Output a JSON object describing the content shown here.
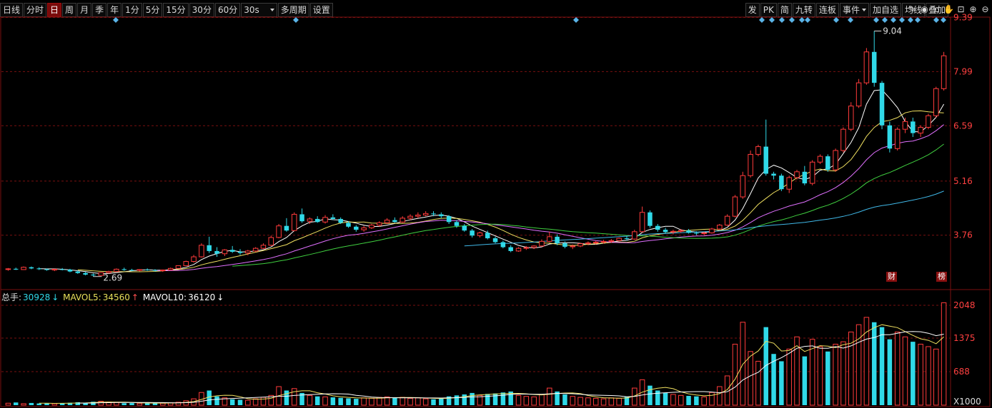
{
  "toolbar": {
    "left_items": [
      {
        "label": "日线",
        "active": false
      },
      {
        "label": "分时",
        "active": false
      },
      {
        "label": "日",
        "active": true
      },
      {
        "label": "周",
        "active": false
      },
      {
        "label": "月",
        "active": false
      },
      {
        "label": "季",
        "active": false
      },
      {
        "label": "年",
        "active": false
      },
      {
        "label": "1分",
        "active": false
      },
      {
        "label": "5分",
        "active": false
      },
      {
        "label": "15分",
        "active": false
      },
      {
        "label": "30分",
        "active": false
      },
      {
        "label": "60分",
        "active": false
      }
    ],
    "period_select": "30s",
    "multi_period": "多周期",
    "settings": "设置",
    "right_items": [
      "发",
      "PK",
      "简",
      "九转",
      "连板",
      "事件",
      "加自选",
      "均线",
      "叠加"
    ],
    "tool_icons": [
      "pen-icon",
      "eye-icon",
      "camera-icon",
      "hand-icon",
      "lock-icon",
      "zoom-in-icon",
      "zoom-out-icon"
    ]
  },
  "price_axis": {
    "labels": [
      "9.39",
      "7.99",
      "6.59",
      "5.16",
      "3.76"
    ]
  },
  "volume_axis": {
    "labels": [
      "2048",
      "1375",
      "688",
      "X1000"
    ]
  },
  "volume_info": {
    "total_label": "总手:",
    "total_value": "30928",
    "mavol5_label": "MAVOL5:",
    "mavol5_value": "34560",
    "mavol10_label": "MAVOL10:",
    "mavol10_value": "36120"
  },
  "markers": {
    "cai": "财",
    "bang": "榜"
  },
  "colors": {
    "up": "#ff3b3b",
    "down": "#30d9e8",
    "ma5": "#ffffff",
    "ma10": "#f0e060",
    "ma20": "#e070ff",
    "ma30": "#40d040",
    "ma60": "#40b8e8",
    "grid": "#7a1010"
  },
  "chart_data": {
    "type": "candlestick",
    "ylim_price": [
      2.5,
      9.4
    ],
    "ylim_volume": [
      0,
      2150
    ],
    "annotations": [
      {
        "text": "9.04",
        "kind": "high"
      },
      {
        "text": "2.69",
        "kind": "low"
      }
    ],
    "candles": [
      [
        2.88,
        2.91,
        2.84,
        2.89
      ],
      [
        2.89,
        2.92,
        2.86,
        2.87
      ],
      [
        2.87,
        2.95,
        2.86,
        2.93
      ],
      [
        2.93,
        2.95,
        2.88,
        2.9
      ],
      [
        2.9,
        2.93,
        2.86,
        2.88
      ],
      [
        2.88,
        2.9,
        2.84,
        2.86
      ],
      [
        2.86,
        2.89,
        2.83,
        2.88
      ],
      [
        2.88,
        2.91,
        2.85,
        2.87
      ],
      [
        2.87,
        2.89,
        2.8,
        2.82
      ],
      [
        2.82,
        2.85,
        2.76,
        2.78
      ],
      [
        2.78,
        2.81,
        2.72,
        2.74
      ],
      [
        2.74,
        2.77,
        2.69,
        2.72
      ],
      [
        2.72,
        2.8,
        2.71,
        2.79
      ],
      [
        2.79,
        2.84,
        2.77,
        2.82
      ],
      [
        2.82,
        2.9,
        2.81,
        2.88
      ],
      [
        2.88,
        2.92,
        2.84,
        2.86
      ],
      [
        2.86,
        2.89,
        2.83,
        2.85
      ],
      [
        2.85,
        2.88,
        2.82,
        2.87
      ],
      [
        2.87,
        2.9,
        2.84,
        2.86
      ],
      [
        2.86,
        2.88,
        2.82,
        2.84
      ],
      [
        2.84,
        2.87,
        2.81,
        2.86
      ],
      [
        2.86,
        2.92,
        2.85,
        2.9
      ],
      [
        2.9,
        2.98,
        2.89,
        2.97
      ],
      [
        2.97,
        3.1,
        2.96,
        3.08
      ],
      [
        3.08,
        3.25,
        3.05,
        3.2
      ],
      [
        3.2,
        3.55,
        3.18,
        3.5
      ],
      [
        3.5,
        3.72,
        3.3,
        3.35
      ],
      [
        3.35,
        3.45,
        3.2,
        3.28
      ],
      [
        3.28,
        3.4,
        3.22,
        3.38
      ],
      [
        3.38,
        3.48,
        3.3,
        3.33
      ],
      [
        3.33,
        3.4,
        3.25,
        3.3
      ],
      [
        3.3,
        3.38,
        3.24,
        3.35
      ],
      [
        3.35,
        3.45,
        3.32,
        3.42
      ],
      [
        3.42,
        3.55,
        3.4,
        3.5
      ],
      [
        3.5,
        3.75,
        3.48,
        3.7
      ],
      [
        3.7,
        4.05,
        3.68,
        4.0
      ],
      [
        4.0,
        4.2,
        3.85,
        3.88
      ],
      [
        3.88,
        4.35,
        3.86,
        4.3
      ],
      [
        4.3,
        4.45,
        4.08,
        4.12
      ],
      [
        4.12,
        4.22,
        4.05,
        4.18
      ],
      [
        4.18,
        4.25,
        4.08,
        4.1
      ],
      [
        4.1,
        4.28,
        4.06,
        4.22
      ],
      [
        4.22,
        4.3,
        4.15,
        4.18
      ],
      [
        4.18,
        4.22,
        4.05,
        4.08
      ],
      [
        4.08,
        4.12,
        3.95,
        3.98
      ],
      [
        3.98,
        4.02,
        3.85,
        3.9
      ],
      [
        3.9,
        4.0,
        3.85,
        3.95
      ],
      [
        3.95,
        4.05,
        3.92,
        4.02
      ],
      [
        4.02,
        4.12,
        3.98,
        4.08
      ],
      [
        4.08,
        4.2,
        4.05,
        4.15
      ],
      [
        4.15,
        4.22,
        4.08,
        4.1
      ],
      [
        4.1,
        4.25,
        4.08,
        4.2
      ],
      [
        4.2,
        4.3,
        4.15,
        4.25
      ],
      [
        4.25,
        4.35,
        4.2,
        4.28
      ],
      [
        4.28,
        4.38,
        4.25,
        4.32
      ],
      [
        4.32,
        4.38,
        4.25,
        4.3
      ],
      [
        4.3,
        4.35,
        4.2,
        4.25
      ],
      [
        4.25,
        4.28,
        4.05,
        4.1
      ],
      [
        4.1,
        4.15,
        3.95,
        4.0
      ],
      [
        4.0,
        4.05,
        3.85,
        3.88
      ],
      [
        3.88,
        3.92,
        3.7,
        3.75
      ],
      [
        3.75,
        3.85,
        3.7,
        3.82
      ],
      [
        3.82,
        3.88,
        3.65,
        3.68
      ],
      [
        3.68,
        3.72,
        3.55,
        3.58
      ],
      [
        3.58,
        3.62,
        3.42,
        3.45
      ],
      [
        3.45,
        3.5,
        3.32,
        3.35
      ],
      [
        3.35,
        3.45,
        3.33,
        3.42
      ],
      [
        3.42,
        3.48,
        3.38,
        3.44
      ],
      [
        3.44,
        3.5,
        3.4,
        3.48
      ],
      [
        3.48,
        3.65,
        3.46,
        3.6
      ],
      [
        3.6,
        3.85,
        3.58,
        3.72
      ],
      [
        3.72,
        3.78,
        3.5,
        3.55
      ],
      [
        3.55,
        3.6,
        3.42,
        3.46
      ],
      [
        3.46,
        3.52,
        3.4,
        3.48
      ],
      [
        3.48,
        3.56,
        3.45,
        3.54
      ],
      [
        3.54,
        3.6,
        3.5,
        3.56
      ],
      [
        3.56,
        3.62,
        3.52,
        3.58
      ],
      [
        3.58,
        3.64,
        3.54,
        3.6
      ],
      [
        3.6,
        3.66,
        3.56,
        3.62
      ],
      [
        3.62,
        3.7,
        3.6,
        3.68
      ],
      [
        3.68,
        3.74,
        3.62,
        3.66
      ],
      [
        3.66,
        3.9,
        3.64,
        3.85
      ],
      [
        3.85,
        4.5,
        3.83,
        4.35
      ],
      [
        4.35,
        4.4,
        3.95,
        4.0
      ],
      [
        4.0,
        4.05,
        3.85,
        3.9
      ],
      [
        3.9,
        3.95,
        3.8,
        3.84
      ],
      [
        3.84,
        3.9,
        3.78,
        3.86
      ],
      [
        3.86,
        3.92,
        3.82,
        3.88
      ],
      [
        3.88,
        3.92,
        3.8,
        3.82
      ],
      [
        3.82,
        3.86,
        3.76,
        3.8
      ],
      [
        3.8,
        3.85,
        3.75,
        3.82
      ],
      [
        3.82,
        3.95,
        3.8,
        3.92
      ],
      [
        3.92,
        4.05,
        3.9,
        4.02
      ],
      [
        4.02,
        4.3,
        4.0,
        4.25
      ],
      [
        4.25,
        4.8,
        4.22,
        4.75
      ],
      [
        4.75,
        5.4,
        4.7,
        5.3
      ],
      [
        5.3,
        5.95,
        5.25,
        5.85
      ],
      [
        5.85,
        6.1,
        5.8,
        6.05
      ],
      [
        6.05,
        6.75,
        5.3,
        5.35
      ],
      [
        5.35,
        5.4,
        5.2,
        5.3
      ],
      [
        5.3,
        5.35,
        4.9,
        4.95
      ],
      [
        4.95,
        5.3,
        4.85,
        5.25
      ],
      [
        5.25,
        5.45,
        5.2,
        5.4
      ],
      [
        5.4,
        5.55,
        5.05,
        5.1
      ],
      [
        5.1,
        5.7,
        5.05,
        5.65
      ],
      [
        5.65,
        5.85,
        5.6,
        5.8
      ],
      [
        5.8,
        5.85,
        5.4,
        5.45
      ],
      [
        5.45,
        6.0,
        5.4,
        5.95
      ],
      [
        5.95,
        6.55,
        5.9,
        6.5
      ],
      [
        6.5,
        7.2,
        6.45,
        7.1
      ],
      [
        7.1,
        7.8,
        7.05,
        7.7
      ],
      [
        7.7,
        8.6,
        7.65,
        8.5
      ],
      [
        8.5,
        9.04,
        7.6,
        7.7
      ],
      [
        7.7,
        7.75,
        6.5,
        6.6
      ],
      [
        6.6,
        6.7,
        5.9,
        6.0
      ],
      [
        6.0,
        6.55,
        5.95,
        6.5
      ],
      [
        6.5,
        6.8,
        6.4,
        6.7
      ],
      [
        6.7,
        6.8,
        6.3,
        6.4
      ],
      [
        6.4,
        6.6,
        6.3,
        6.55
      ],
      [
        6.55,
        6.9,
        6.5,
        6.85
      ],
      [
        6.85,
        7.6,
        6.8,
        7.55
      ],
      [
        7.55,
        8.5,
        7.5,
        8.4
      ]
    ],
    "volumes": [
      40,
      55,
      30,
      45,
      35,
      38,
      32,
      40,
      50,
      60,
      45,
      70,
      80,
      65,
      55,
      40,
      42,
      38,
      45,
      50,
      40,
      48,
      60,
      90,
      130,
      260,
      300,
      180,
      150,
      120,
      110,
      100,
      130,
      160,
      200,
      380,
      300,
      340,
      250,
      200,
      180,
      170,
      160,
      150,
      140,
      130,
      150,
      140,
      160,
      170,
      150,
      160,
      140,
      150,
      130,
      120,
      140,
      180,
      200,
      220,
      250,
      200,
      230,
      240,
      260,
      280,
      200,
      180,
      170,
      220,
      350,
      280,
      220,
      180,
      160,
      150,
      140,
      130,
      150,
      140,
      170,
      350,
      520,
      400,
      300,
      250,
      220,
      200,
      190,
      180,
      170,
      260,
      380,
      600,
      1250,
      1700,
      1100,
      900,
      1600,
      1050,
      900,
      1150,
      1400,
      1000,
      1350,
      1200,
      1100,
      1250,
      1300,
      1500,
      1650,
      1800,
      1700,
      1600,
      1350,
      1500,
      1400,
      1300,
      1250,
      1200,
      1150,
      2100
    ],
    "volume_up_highlight": []
  }
}
